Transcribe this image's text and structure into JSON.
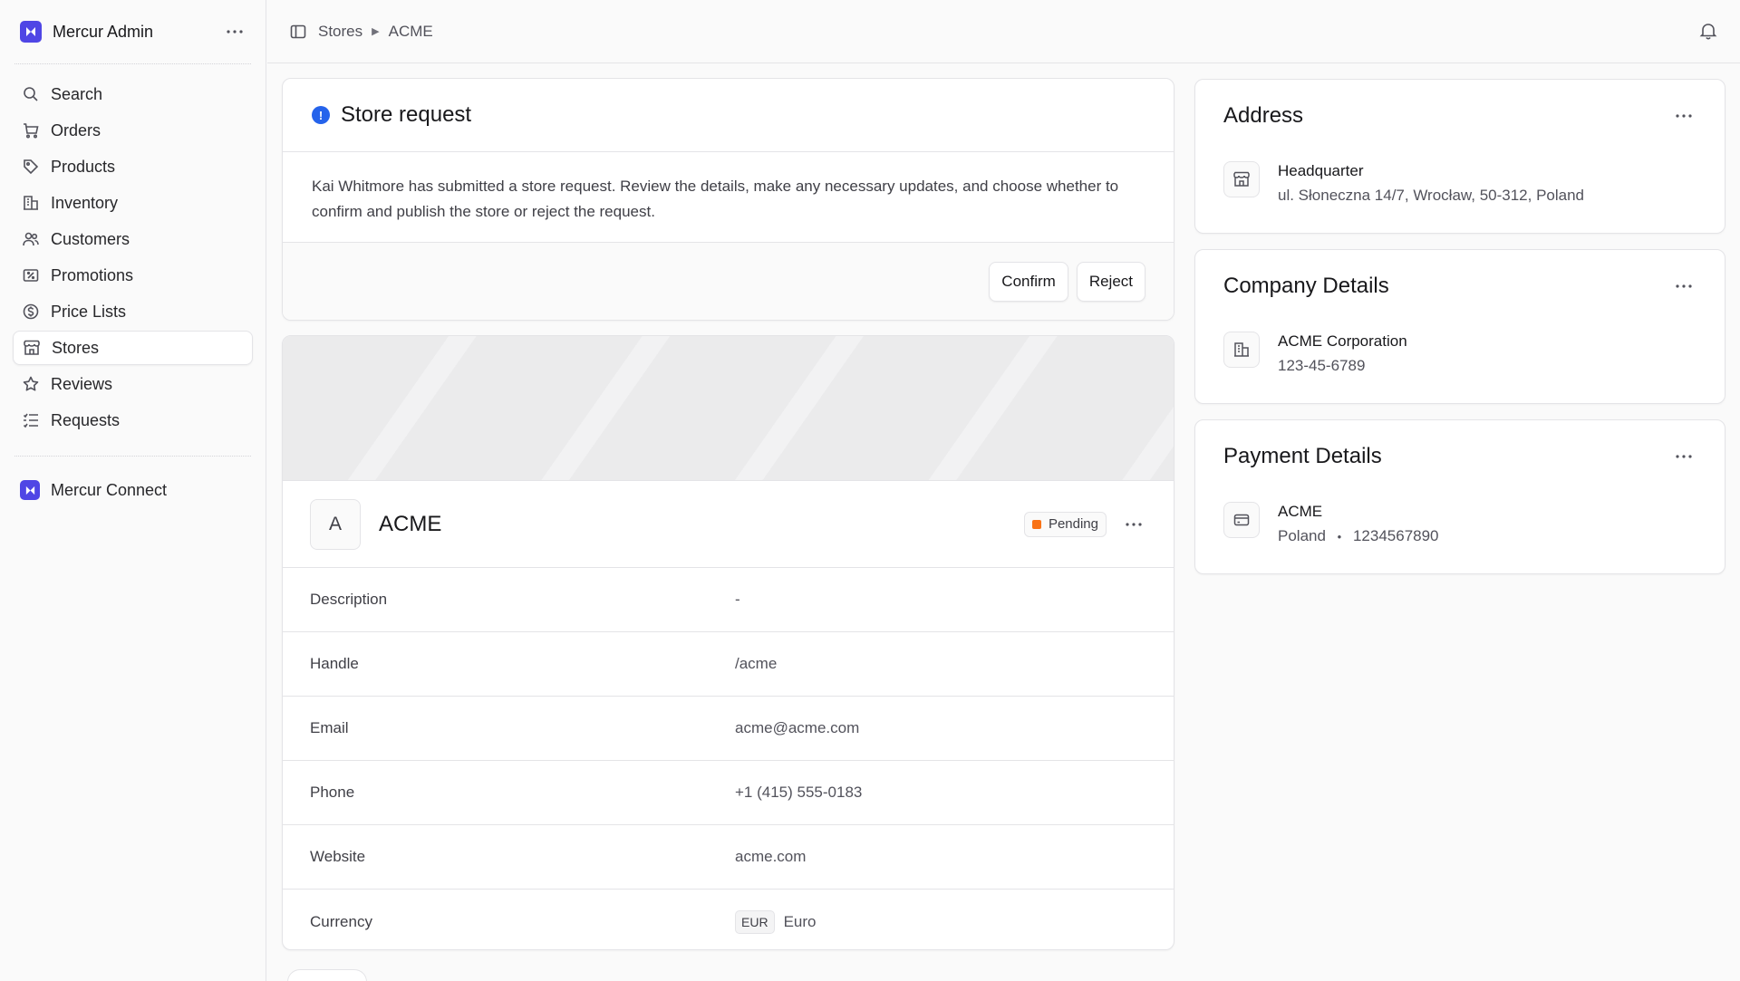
{
  "sidebar": {
    "brand": "Mercur Admin",
    "items": [
      {
        "label": "Search",
        "icon": "search-icon"
      },
      {
        "label": "Orders",
        "icon": "cart-icon"
      },
      {
        "label": "Products",
        "icon": "tag-icon"
      },
      {
        "label": "Inventory",
        "icon": "building-icon"
      },
      {
        "label": "Customers",
        "icon": "users-icon"
      },
      {
        "label": "Promotions",
        "icon": "receipt-percent-icon"
      },
      {
        "label": "Price Lists",
        "icon": "currency-dollar-icon"
      },
      {
        "label": "Stores",
        "icon": "store-icon",
        "active": true
      },
      {
        "label": "Reviews",
        "icon": "star-icon"
      },
      {
        "label": "Requests",
        "icon": "list-checkbox-icon"
      }
    ],
    "connect": "Mercur Connect"
  },
  "breadcrumb": [
    "Stores",
    "ACME"
  ],
  "request": {
    "title": "Store request",
    "body": "Kai Whitmore has submitted a store request. Review the details, make any necessary updates, and choose whether to confirm and publish the store or reject the request.",
    "confirm_label": "Confirm",
    "reject_label": "Reject"
  },
  "store": {
    "avatar_letter": "A",
    "name": "ACME",
    "status": "Pending",
    "status_color": "#f97316",
    "fields": {
      "description": {
        "label": "Description",
        "value": "-"
      },
      "handle": {
        "label": "Handle",
        "value": "/acme"
      },
      "email": {
        "label": "Email",
        "value": "acme@acme.com"
      },
      "phone": {
        "label": "Phone",
        "value": "+1 (415) 555-0183"
      },
      "website": {
        "label": "Website",
        "value": "acme.com"
      },
      "currency": {
        "label": "Currency",
        "code": "EUR",
        "value": "Euro"
      }
    }
  },
  "address": {
    "title": "Address",
    "name": "Headquarter",
    "line": "ul. Słoneczna 14/7, Wrocław, 50-312, Poland"
  },
  "company": {
    "title": "Company Details",
    "name": "ACME Corporation",
    "number": "123-45-6789"
  },
  "payment": {
    "title": "Payment Details",
    "name": "ACME",
    "country": "Poland",
    "separator": "•",
    "account": "1234567890"
  },
  "colors": {
    "brand": "#4f46e5",
    "info": "#2563eb",
    "pending": "#f97316"
  }
}
